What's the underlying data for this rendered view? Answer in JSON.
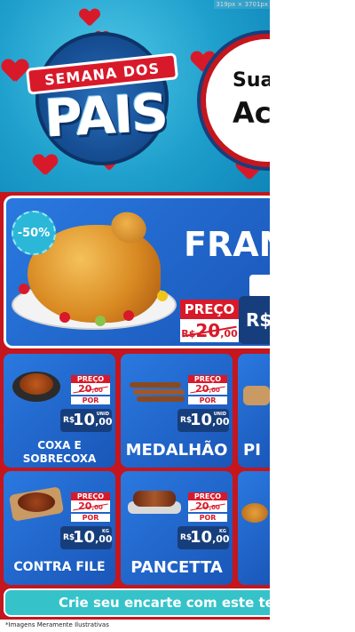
{
  "size_badge": "319px × 3701px",
  "header": {
    "banner_text": "SEMANA DOS",
    "main_text": "PAIS",
    "promo_line1": "Sua",
    "promo_line2": "Ac"
  },
  "featured": {
    "discount": "-50%",
    "title": "FRAN",
    "preco_label": "PREÇO",
    "old_price": "20",
    "old_cents": ",00",
    "old_currency": "R$",
    "currency": "R$"
  },
  "products": [
    {
      "name_line1": "COXA E",
      "name_line2": "SOBRECOXA",
      "preco_label": "PREÇO",
      "old": "20",
      "old_cents": ",00",
      "por": "POR",
      "currency": "R$",
      "price": "10",
      "cents": ",00",
      "unit": "UNID"
    },
    {
      "name_line1": "MEDALHÃO",
      "name_line2": "",
      "preco_label": "PREÇO",
      "old": "20",
      "old_cents": ",00",
      "por": "POR",
      "currency": "R$",
      "price": "10",
      "cents": ",00",
      "unit": "UNID"
    },
    {
      "name_line1": "PI",
      "name_line2": "",
      "preco_label": "",
      "old": "",
      "old_cents": "",
      "por": "",
      "currency": "",
      "price": "",
      "cents": "",
      "unit": ""
    },
    {
      "name_line1": "CONTRA FILE",
      "name_line2": "",
      "preco_label": "PREÇO",
      "old": "20",
      "old_cents": ",00",
      "por": "POR",
      "currency": "R$",
      "price": "10",
      "cents": ",00",
      "unit": "KG"
    },
    {
      "name_line1": "PANCETTA",
      "name_line2": "",
      "preco_label": "PREÇO",
      "old": "20",
      "old_cents": ",00",
      "por": "POR",
      "currency": "R$",
      "price": "10",
      "cents": ",00",
      "unit": "KG"
    }
  ],
  "cta": "Crie seu encarte com este te",
  "footnote": "*Imagens Meramente Ilustrativas",
  "colors": {
    "accent_red": "#d8192a",
    "card_blue": "#1a56b8",
    "price_navy": "#173e7c",
    "cta_teal": "#35c3c9",
    "sky_blue": "#1e9fcc"
  }
}
